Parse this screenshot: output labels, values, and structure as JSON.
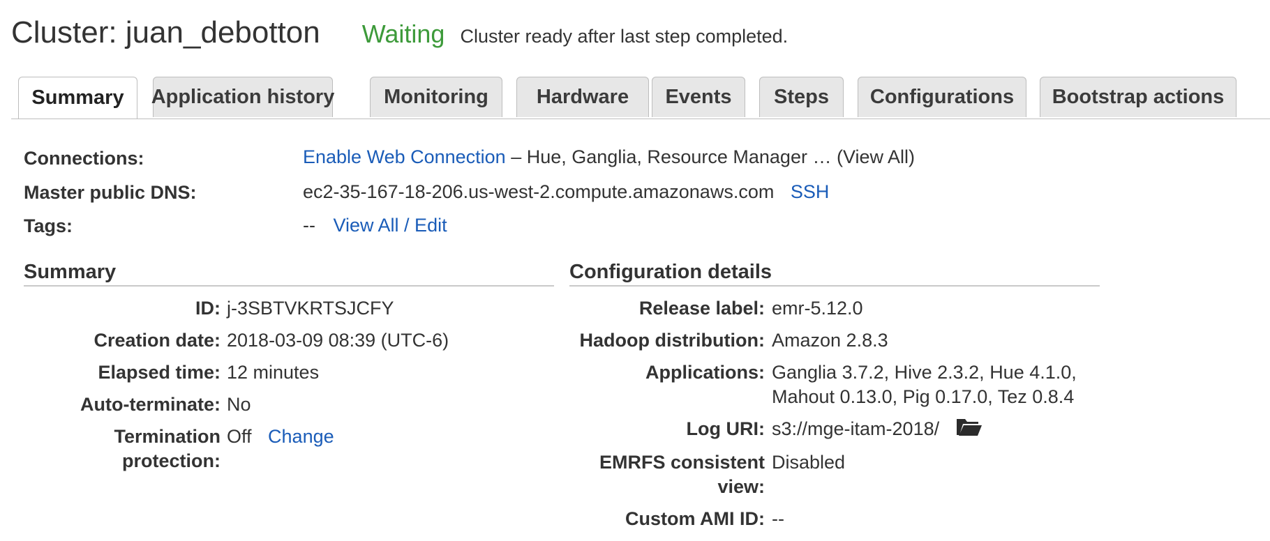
{
  "header": {
    "cluster_title": "Cluster: juan_debotton",
    "status": "Waiting",
    "status_message": "Cluster ready after last step completed.",
    "status_color": "#3d9a3a"
  },
  "tabs": [
    {
      "label": "Summary",
      "active": true
    },
    {
      "label": "Application history"
    },
    {
      "label": "Monitoring"
    },
    {
      "label": "Hardware"
    },
    {
      "label": "Events"
    },
    {
      "label": "Steps"
    },
    {
      "label": "Configurations"
    },
    {
      "label": "Bootstrap actions"
    }
  ],
  "overview": {
    "connections_label": "Connections:",
    "connections_link": "Enable Web Connection",
    "connections_text": "– Hue, Ganglia, Resource Manager … (View All)",
    "dns_label": "Master public DNS:",
    "dns_value": "ec2-35-167-18-206.us-west-2.compute.amazonaws.com",
    "ssh_link": "SSH",
    "tags_label": "Tags:",
    "tags_value": "--",
    "tags_link": "View All / Edit"
  },
  "summary": {
    "title": "Summary",
    "id_label": "ID:",
    "id_value": "j-3SBTVKRTSJCFY",
    "creation_label": "Creation date:",
    "creation_value": "2018-03-09 08:39 (UTC-6)",
    "elapsed_label": "Elapsed time:",
    "elapsed_value": "12 minutes",
    "autoterm_label": "Auto-terminate:",
    "autoterm_value": "No",
    "termprot_label_1": "Termination",
    "termprot_label_2": "protection:",
    "termprot_value": "Off",
    "termprot_link": "Change"
  },
  "config": {
    "title": "Configuration details",
    "release_label": "Release label:",
    "release_value": "emr-5.12.0",
    "hadoop_label": "Hadoop distribution:",
    "hadoop_value": "Amazon 2.8.3",
    "apps_label": "Applications:",
    "apps_value_1": "Ganglia 3.7.2, Hive 2.3.2, Hue 4.1.0,",
    "apps_value_2": "Mahout 0.13.0, Pig 0.17.0, Tez 0.8.4",
    "log_label": "Log URI:",
    "log_value": "s3://mge-itam-2018/",
    "log_icon": "folder-open-icon",
    "emrfs_label_1": "EMRFS consistent",
    "emrfs_label_2": "view:",
    "emrfs_value": "Disabled",
    "ami_label": "Custom AMI ID:",
    "ami_value": "--"
  },
  "colors": {
    "link": "#1a5cb8",
    "tab_bg": "#e7e7e7",
    "rule": "#c9c9c9"
  }
}
